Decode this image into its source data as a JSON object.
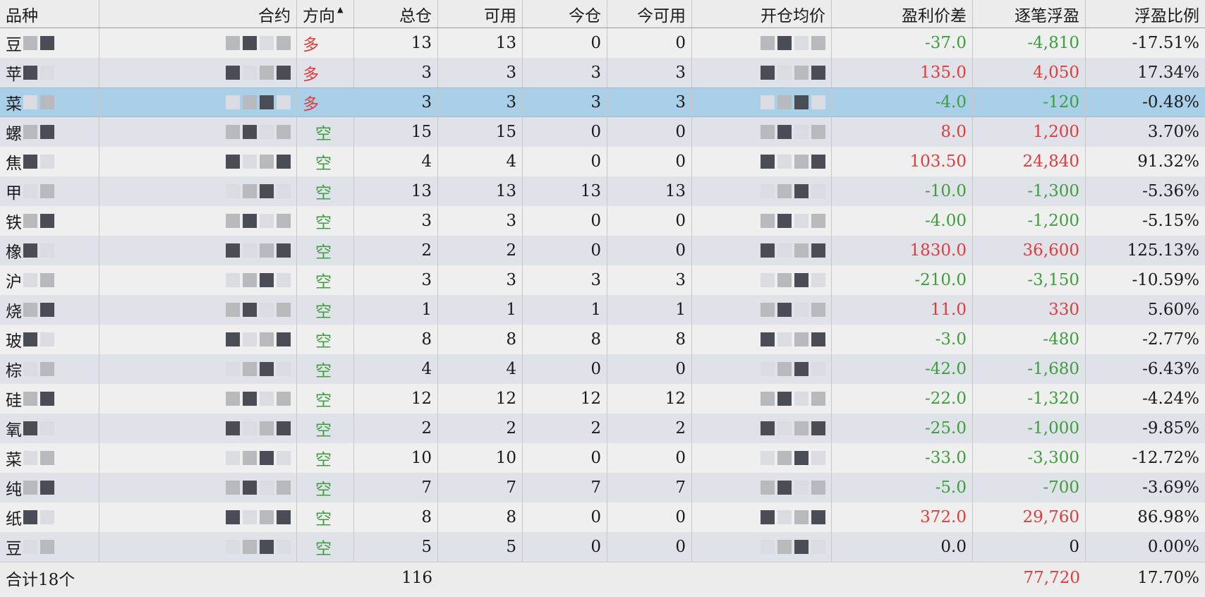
{
  "columns": {
    "variety": "品种",
    "contract": "合约",
    "direction": "方向",
    "total": "总仓",
    "available": "可用",
    "today": "今仓",
    "today_available": "今可用",
    "open_avg": "开仓均价",
    "profit_diff": "盈利价差",
    "float_pl": "逐笔浮盈",
    "float_ratio": "浮盈比例"
  },
  "sort_indicator": "▲",
  "rows": [
    {
      "variety": "豆",
      "direction": "多",
      "total": "13",
      "available": "13",
      "today": "0",
      "today_available": "0",
      "profit_diff": "-37.0",
      "float_pl": "-4,810",
      "float_ratio": "-17.51%",
      "sign": "neg"
    },
    {
      "variety": "苹",
      "direction": "多",
      "total": "3",
      "available": "3",
      "today": "3",
      "today_available": "3",
      "profit_diff": "135.0",
      "float_pl": "4,050",
      "float_ratio": "17.34%",
      "sign": "pos"
    },
    {
      "variety": "菜",
      "direction": "多",
      "total": "3",
      "available": "3",
      "today": "3",
      "today_available": "3",
      "profit_diff": "-4.0",
      "float_pl": "-120",
      "float_ratio": "-0.48%",
      "sign": "neg"
    },
    {
      "variety": "螺",
      "direction": "空",
      "total": "15",
      "available": "15",
      "today": "0",
      "today_available": "0",
      "profit_diff": "8.0",
      "float_pl": "1,200",
      "float_ratio": "3.70%",
      "sign": "pos"
    },
    {
      "variety": "焦",
      "direction": "空",
      "total": "4",
      "available": "4",
      "today": "0",
      "today_available": "0",
      "profit_diff": "103.50",
      "float_pl": "24,840",
      "float_ratio": "91.32%",
      "sign": "pos"
    },
    {
      "variety": "甲",
      "direction": "空",
      "total": "13",
      "available": "13",
      "today": "13",
      "today_available": "13",
      "profit_diff": "-10.0",
      "float_pl": "-1,300",
      "float_ratio": "-5.36%",
      "sign": "neg"
    },
    {
      "variety": "铁",
      "direction": "空",
      "total": "3",
      "available": "3",
      "today": "0",
      "today_available": "0",
      "profit_diff": "-4.00",
      "float_pl": "-1,200",
      "float_ratio": "-5.15%",
      "sign": "neg"
    },
    {
      "variety": "橡",
      "direction": "空",
      "total": "2",
      "available": "2",
      "today": "0",
      "today_available": "0",
      "profit_diff": "1830.0",
      "float_pl": "36,600",
      "float_ratio": "125.13%",
      "sign": "pos"
    },
    {
      "variety": "沪",
      "direction": "空",
      "total": "3",
      "available": "3",
      "today": "3",
      "today_available": "3",
      "profit_diff": "-210.0",
      "float_pl": "-3,150",
      "float_ratio": "-10.59%",
      "sign": "neg"
    },
    {
      "variety": "烧",
      "direction": "空",
      "total": "1",
      "available": "1",
      "today": "1",
      "today_available": "1",
      "profit_diff": "11.0",
      "float_pl": "330",
      "float_ratio": "5.60%",
      "sign": "pos"
    },
    {
      "variety": "玻",
      "direction": "空",
      "total": "8",
      "available": "8",
      "today": "8",
      "today_available": "8",
      "profit_diff": "-3.0",
      "float_pl": "-480",
      "float_ratio": "-2.77%",
      "sign": "neg"
    },
    {
      "variety": "棕",
      "direction": "空",
      "total": "4",
      "available": "4",
      "today": "0",
      "today_available": "0",
      "profit_diff": "-42.0",
      "float_pl": "-1,680",
      "float_ratio": "-6.43%",
      "sign": "neg"
    },
    {
      "variety": "硅",
      "direction": "空",
      "total": "12",
      "available": "12",
      "today": "12",
      "today_available": "12",
      "profit_diff": "-22.0",
      "float_pl": "-1,320",
      "float_ratio": "-4.24%",
      "sign": "neg"
    },
    {
      "variety": "氧",
      "direction": "空",
      "total": "2",
      "available": "2",
      "today": "2",
      "today_available": "2",
      "profit_diff": "-25.0",
      "float_pl": "-1,000",
      "float_ratio": "-9.85%",
      "sign": "neg"
    },
    {
      "variety": "菜",
      "direction": "空",
      "total": "10",
      "available": "10",
      "today": "0",
      "today_available": "0",
      "profit_diff": "-33.0",
      "float_pl": "-3,300",
      "float_ratio": "-12.72%",
      "sign": "neg"
    },
    {
      "variety": "纯",
      "direction": "空",
      "total": "7",
      "available": "7",
      "today": "7",
      "today_available": "7",
      "profit_diff": "-5.0",
      "float_pl": "-700",
      "float_ratio": "-3.69%",
      "sign": "neg"
    },
    {
      "variety": "纸",
      "direction": "空",
      "total": "8",
      "available": "8",
      "today": "0",
      "today_available": "0",
      "profit_diff": "372.0",
      "float_pl": "29,760",
      "float_ratio": "86.98%",
      "sign": "pos"
    },
    {
      "variety": "豆",
      "direction": "空",
      "total": "5",
      "available": "5",
      "today": "0",
      "today_available": "0",
      "profit_diff": "0.0",
      "float_pl": "0",
      "float_ratio": "0.00%",
      "sign": "zero"
    }
  ],
  "selected_row": 2,
  "summary": {
    "label": "合计18个",
    "total": "116",
    "float_pl": "77,720",
    "float_ratio": "17.70%"
  },
  "colors": {
    "positive": "#e03c3c",
    "negative": "#3c9e3c",
    "selected": "#a9cfe9"
  }
}
